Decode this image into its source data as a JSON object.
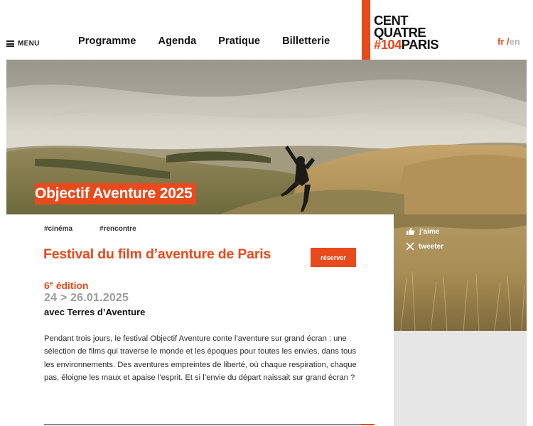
{
  "header": {
    "menu_label": "MENU",
    "nav": [
      {
        "label": "Programme"
      },
      {
        "label": "Agenda"
      },
      {
        "label": "Pratique"
      },
      {
        "label": "Billetterie"
      }
    ],
    "logo": {
      "line1": "CENT",
      "line2": "QUATRE",
      "line3_accent": "#104",
      "line3_rest": "PARIS"
    },
    "lang": {
      "fr": "fr",
      "sep": "/",
      "en": "en"
    }
  },
  "hero": {
    "title": "Objectif Aventure 2025"
  },
  "event": {
    "tags": [
      "#cinéma",
      "#rencontre"
    ],
    "title": "Festival du film d’aventure de Paris",
    "edition_number": "6",
    "edition_sup": "e",
    "edition_word": "édition",
    "dates": "24 > 26.01.2025",
    "partner": "avec Terres d’Aventure",
    "reserve_label": "réserver",
    "description": "Pendant trois jours, le festival Objectif Aventure conte l’aventure  sur grand écran : une sélection de films qui traverse le monde et les époques pour toutes les envies, dans tous les environnements. Des aventures empreintes de liberté, où chaque respiration, chaque pas, éloigne les maux et apaise l’esprit. Et si l’envie du départ naissait sur grand écran ?"
  },
  "social": {
    "like_label": "j’aime",
    "tweet_label": "tweeter"
  },
  "colors": {
    "accent": "#e84a1c",
    "muted_text": "#9c9c9c"
  },
  "icons": [
    "hamburger-icon",
    "thumbs-up-icon",
    "x-twitter-icon"
  ]
}
